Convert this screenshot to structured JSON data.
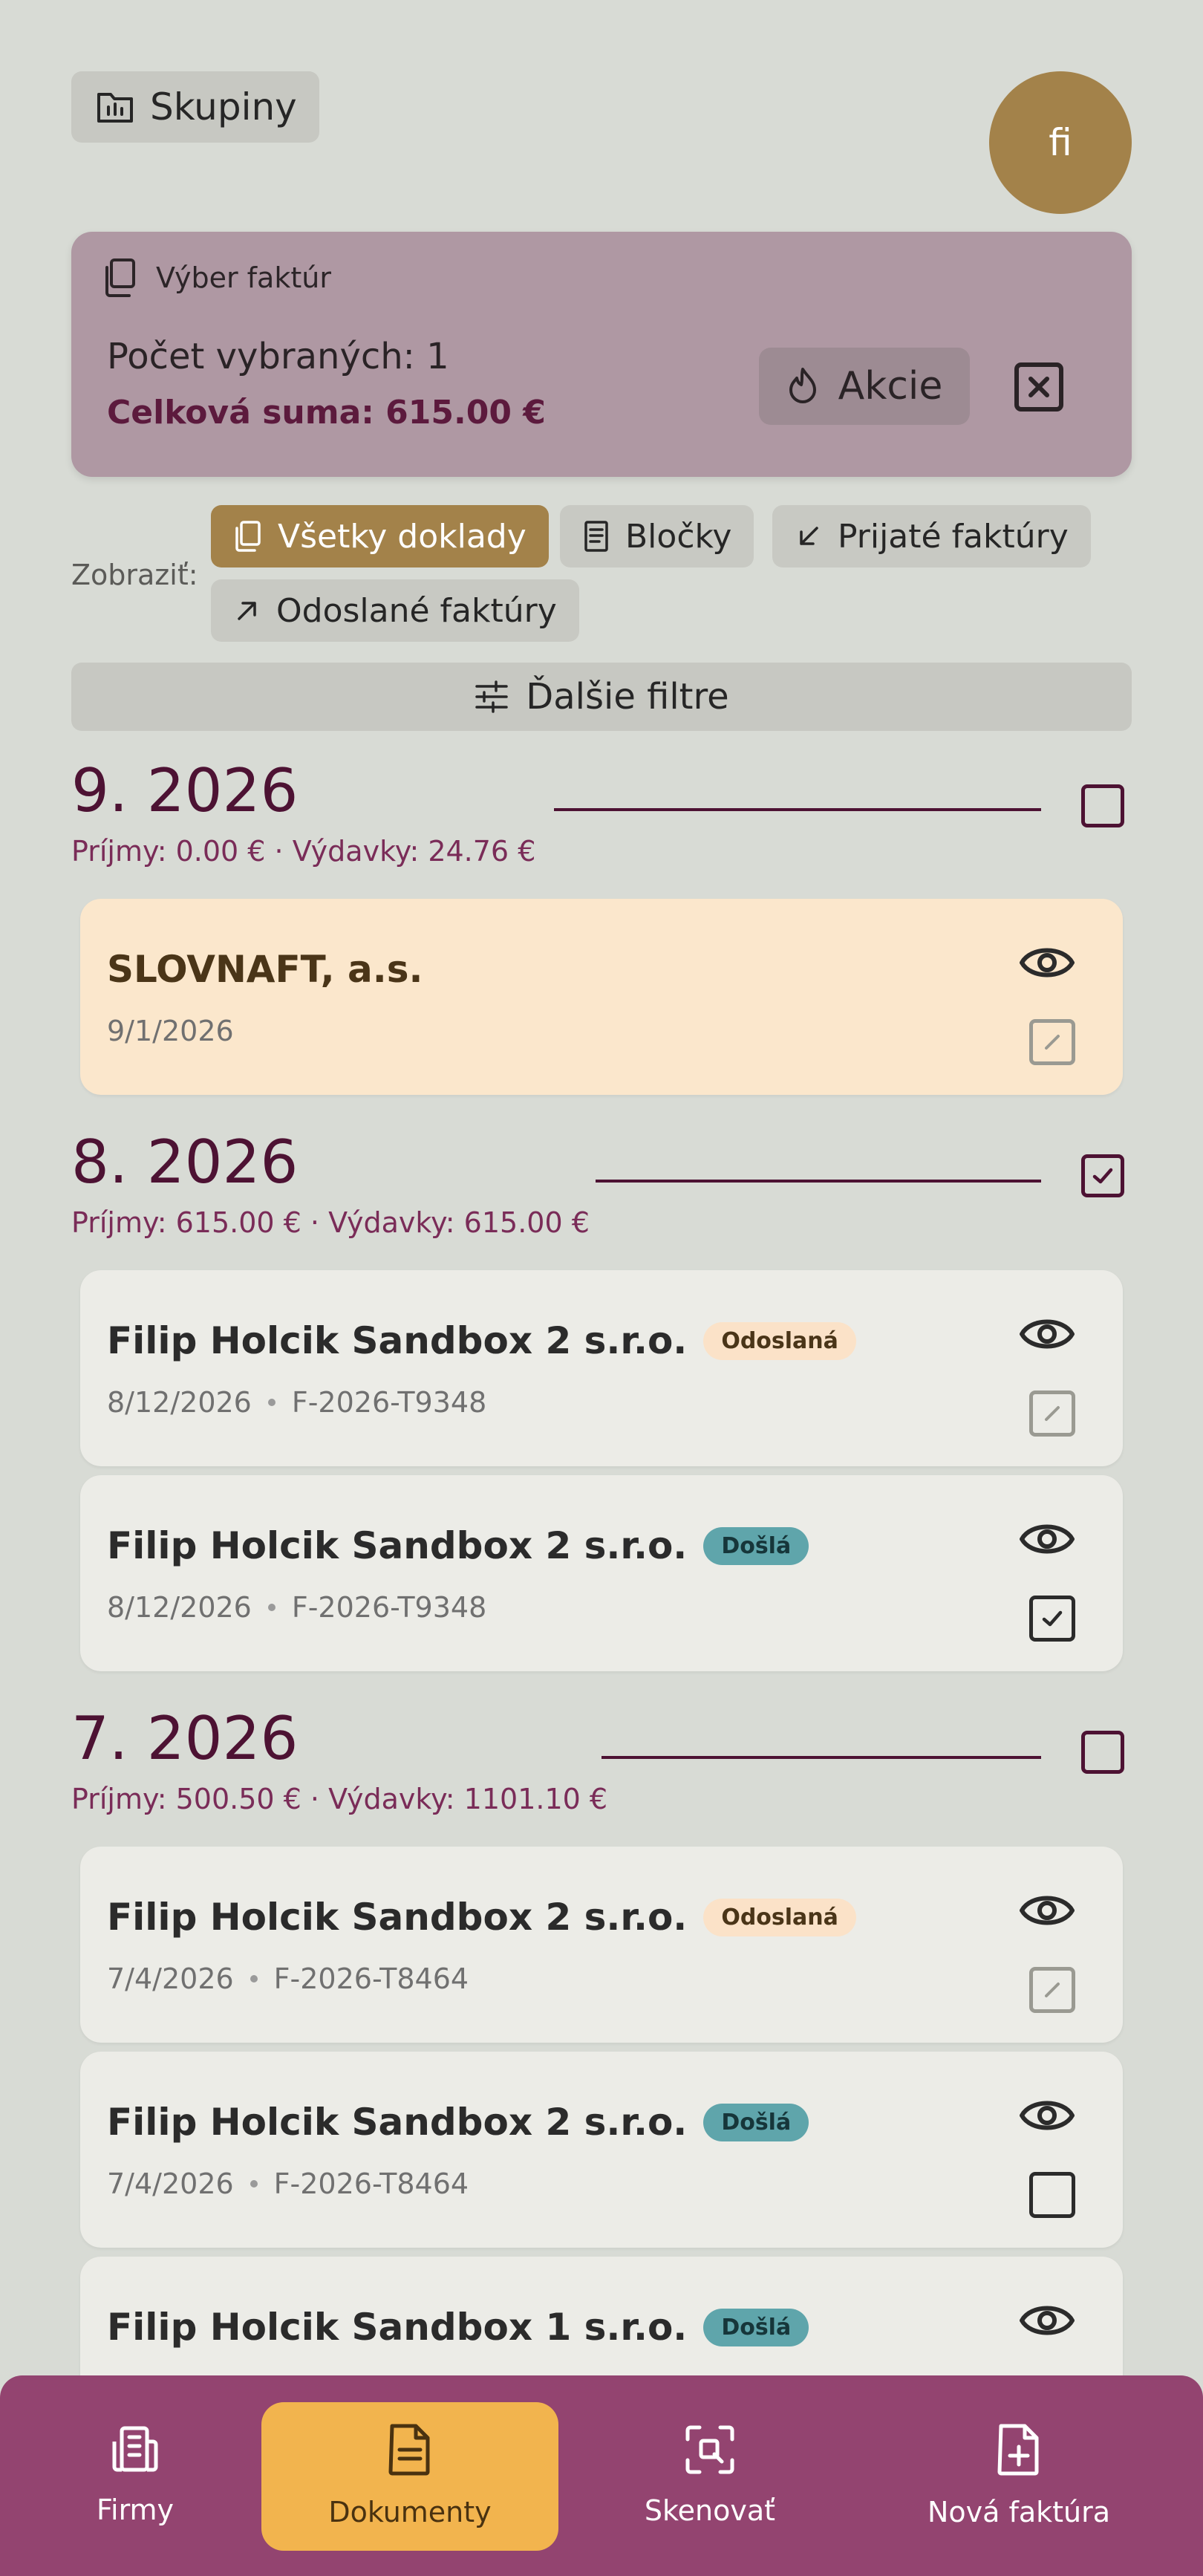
{
  "header": {
    "groups_label": "Skupiny",
    "avatar_initials": "fi"
  },
  "selection": {
    "title": "Výber faktúr",
    "count_text": "Počet vybraných: 1",
    "sum_text": "Celková suma: 615.00 €",
    "actions_label": "Akcie"
  },
  "filters": {
    "show_label": "Zobraziť:",
    "chips": [
      {
        "label": "Všetky doklady",
        "active": true
      },
      {
        "label": "Bločky",
        "active": false
      },
      {
        "label": "Prijaté faktúry",
        "active": false
      },
      {
        "label": "Odoslané faktúry",
        "active": false
      }
    ],
    "more_filters_label": "Ďalšie filtre"
  },
  "months": [
    {
      "title": "9. 2026",
      "summary": "Príjmy: 0.00 € · Výdavky: 24.76 €",
      "checked": false
    },
    {
      "title": "8. 2026",
      "summary": "Príjmy: 615.00 € · Výdavky: 615.00 €",
      "checked": true
    },
    {
      "title": "7. 2026",
      "summary": "Príjmy: 500.50 € · Výdavky: 1101.10 €",
      "checked": false
    }
  ],
  "documents": [
    {
      "title": "SLOVNAFT, a.s.",
      "date": "9/1/2026",
      "number": "",
      "badge": "",
      "selectable": false,
      "checked": false
    },
    {
      "title": "Filip Holcik Sandbox 2 s.r.o.",
      "date": "8/12/2026",
      "number": "F-2026-T9348",
      "badge": "Odoslaná",
      "selectable": false,
      "checked": false
    },
    {
      "title": "Filip Holcik Sandbox 2 s.r.o.",
      "date": "8/12/2026",
      "number": "F-2026-T9348",
      "badge": "Došlá",
      "selectable": true,
      "checked": true
    },
    {
      "title": "Filip Holcik Sandbox 2 s.r.o.",
      "date": "7/4/2026",
      "number": "F-2026-T8464",
      "badge": "Odoslaná",
      "selectable": false,
      "checked": false
    },
    {
      "title": "Filip Holcik Sandbox 2 s.r.o.",
      "date": "7/4/2026",
      "number": "F-2026-T8464",
      "badge": "Došlá",
      "selectable": true,
      "checked": false
    },
    {
      "title": "Filip Holcik Sandbox 1 s.r.o.",
      "date": "",
      "number": "",
      "badge": "Došlá",
      "selectable": true,
      "checked": false
    }
  ],
  "nav": {
    "items": [
      {
        "label": "Firmy",
        "icon": "companies-icon"
      },
      {
        "label": "Dokumenty",
        "icon": "document-icon",
        "active": true
      },
      {
        "label": "Skenovať",
        "icon": "scan-icon"
      },
      {
        "label": "Nová faktúra",
        "icon": "new-invoice-icon"
      }
    ]
  },
  "colors": {
    "background": "#d8dbd5",
    "accent_gold": "#a3824a",
    "plum": "#4d1233",
    "nav_bar": "#934470",
    "nav_active": "#f2b44e",
    "selection_panel": "#af98a3"
  }
}
